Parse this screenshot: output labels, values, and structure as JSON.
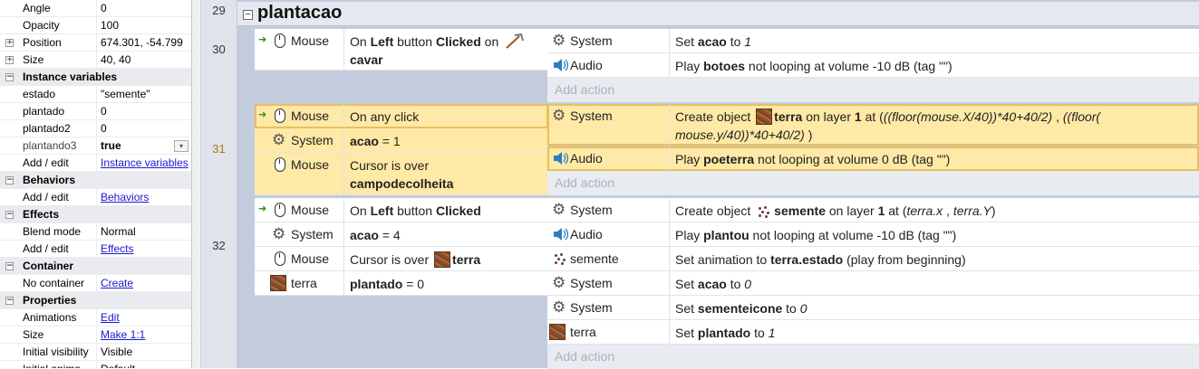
{
  "properties": {
    "rows": [
      {
        "type": "prop",
        "key": "Angle",
        "value": "0"
      },
      {
        "type": "prop",
        "key": "Opacity",
        "value": "100"
      },
      {
        "type": "prop",
        "key": "Position",
        "value": "674.301, -54.799",
        "expand": "+"
      },
      {
        "type": "prop",
        "key": "Size",
        "value": "40, 40",
        "expand": "+"
      },
      {
        "type": "cat",
        "key": "Instance variables"
      },
      {
        "type": "prop",
        "key": "estado",
        "value": "\"semente\""
      },
      {
        "type": "prop",
        "key": "plantado",
        "value": "0"
      },
      {
        "type": "prop",
        "key": "plantado2",
        "value": "0"
      },
      {
        "type": "prop",
        "key": "plantando3",
        "value": "true",
        "bold": true,
        "dropdown": true,
        "muted": true
      },
      {
        "type": "prop",
        "key": "Add / edit",
        "value": "Instance variables",
        "link": true
      },
      {
        "type": "cat",
        "key": "Behaviors"
      },
      {
        "type": "prop",
        "key": "Add / edit",
        "value": "Behaviors",
        "link": true
      },
      {
        "type": "cat",
        "key": "Effects"
      },
      {
        "type": "prop",
        "key": "Blend mode",
        "value": "Normal"
      },
      {
        "type": "prop",
        "key": "Add / edit",
        "value": "Effects",
        "link": true
      },
      {
        "type": "cat",
        "key": "Container"
      },
      {
        "type": "prop",
        "key": "No container",
        "value": "Create",
        "link": true
      },
      {
        "type": "cat",
        "key": "Properties"
      },
      {
        "type": "prop",
        "key": "Animations",
        "value": "Edit",
        "link": true
      },
      {
        "type": "prop",
        "key": "Size",
        "value": "Make 1:1",
        "link": true
      },
      {
        "type": "prop",
        "key": "Initial visibility",
        "value": "Visible"
      },
      {
        "type": "prop",
        "key": "Initial anima",
        "value": "Default"
      }
    ]
  },
  "sheet": {
    "group": {
      "line": "29",
      "name": "plantacao",
      "expand": "−"
    },
    "add_action_label": "Add action",
    "events": [
      {
        "line": "30"
      },
      {
        "line": "31"
      },
      {
        "line": "32"
      }
    ],
    "e30": {
      "c1": {
        "trigger": "➜",
        "obj": "Mouse",
        "pre": "On ",
        "b1": "Left",
        "mid": " button ",
        "b2": "Clicked",
        "post": " on",
        "b3": "cavar"
      },
      "a1": {
        "obj": "System",
        "pre": "Set ",
        "b1": "acao",
        "mid": " to ",
        "i1": "1"
      },
      "a2": {
        "obj": "Audio",
        "pre": "Play ",
        "b1": "botoes",
        "post": " not looping at volume -10 dB (tag \"\")"
      }
    },
    "e31": {
      "c1": {
        "trigger": "➜",
        "obj": "Mouse",
        "text": "On any click"
      },
      "c2": {
        "obj": "System",
        "b1": "acao",
        "post": " = 1"
      },
      "c3": {
        "obj": "Mouse",
        "pre": "Cursor is over",
        "b1": "campodecolheita"
      },
      "a1": {
        "obj": "System",
        "pre": "Create object ",
        "b1": "terra",
        "mid": " on layer ",
        "b2": "1",
        "mid2": " at (",
        "i1": "((floor(mouse.X/40))*40+40/2)",
        "mid3": "   , ",
        "i2": "((floor(",
        "i3": "mouse.y/40))*40+40/2)",
        "post": "  )"
      },
      "a2": {
        "obj": "Audio",
        "pre": "Play ",
        "b1": "poeterra",
        "post": " not looping at volume 0 dB (tag \"\")"
      }
    },
    "e32": {
      "c1": {
        "trigger": "➜",
        "obj": "Mouse",
        "pre": "On ",
        "b1": "Left",
        "mid": " button ",
        "b2": "Clicked"
      },
      "c2": {
        "obj": "System",
        "b1": "acao",
        "post": " = 4"
      },
      "c3": {
        "obj": "Mouse",
        "pre": "Cursor is over ",
        "b1": "terra"
      },
      "c4": {
        "obj": "terra",
        "b1": "plantado",
        "post": " = 0"
      },
      "a1": {
        "obj": "System",
        "pre": "Create object ",
        "b1": "semente",
        "mid": " on layer ",
        "b2": "1",
        "mid2": " at (",
        "i1": "terra.x",
        "mid3": " , ",
        "i2": "terra.Y",
        "post": ")"
      },
      "a2": {
        "obj": "Audio",
        "pre": "Play ",
        "b1": "plantou",
        "post": " not looping at volume -10 dB (tag \"\")"
      },
      "a3": {
        "obj": "semente",
        "pre": "Set animation to ",
        "b1": "terra.estado",
        "post": " (play from beginning)"
      },
      "a4": {
        "obj": "System",
        "pre": "Set ",
        "b1": "acao",
        "mid": " to ",
        "i1": "0"
      },
      "a5": {
        "obj": "System",
        "pre": "Set ",
        "b1": "sementeicone",
        "mid": " to ",
        "i1": "0"
      },
      "a6": {
        "obj": "terra",
        "pre": "Set ",
        "b1": "plantado",
        "mid": " to ",
        "i1": "1"
      }
    },
    "icons": {
      "mouse": "mouse-icon",
      "system": "gear-icon",
      "audio": "speaker-icon",
      "terra": "terra-sprite-icon",
      "semente": "semente-sprite-icon",
      "cavar": "pickaxe-icon"
    }
  }
}
